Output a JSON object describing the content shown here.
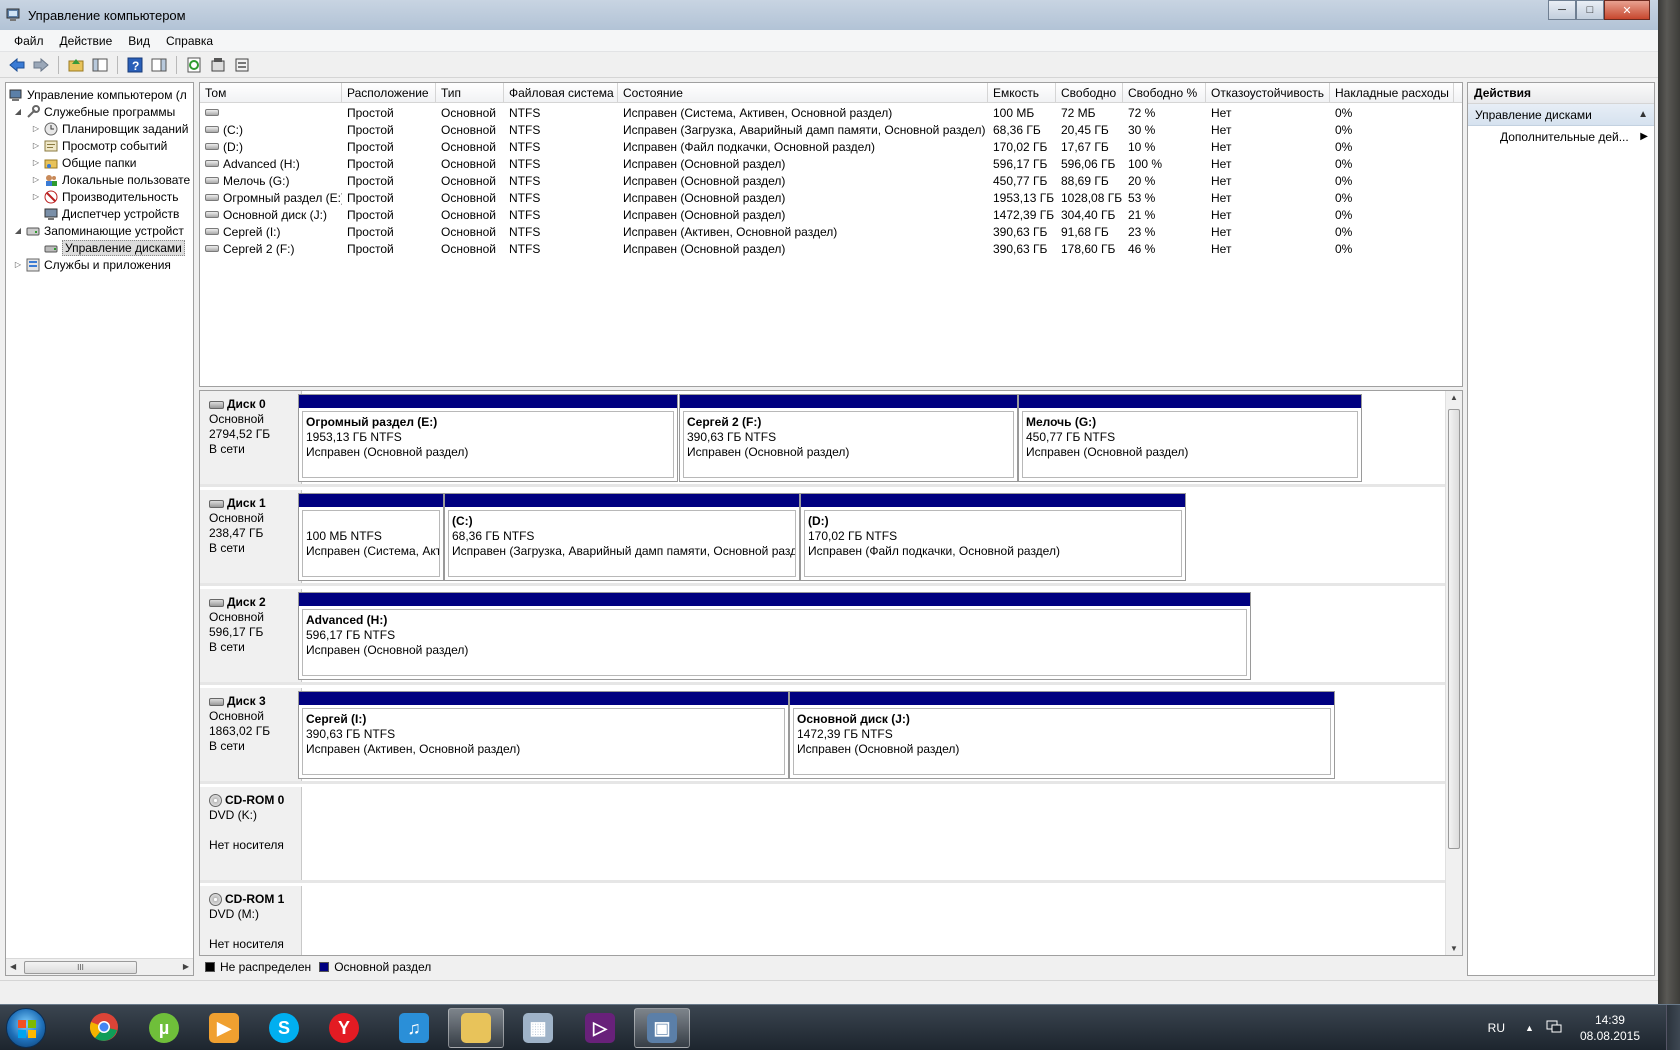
{
  "window": {
    "title": "Управление компьютером",
    "controls": {
      "minimize": "─",
      "maximize": "□",
      "close": "✕"
    }
  },
  "menu": [
    "Файл",
    "Действие",
    "Вид",
    "Справка"
  ],
  "toolbar_icons": [
    "back-arrow-icon",
    "forward-arrow-icon",
    "up-folder-icon",
    "show-hide-tree-icon",
    "help-icon",
    "show-hide-action-pane-icon",
    "refresh-icon",
    "properties-icon",
    "export-icon"
  ],
  "tree": {
    "root": "Управление компьютером (л",
    "items": [
      {
        "label": "Служебные программы",
        "level": 1,
        "expanded": true
      },
      {
        "label": "Планировщик заданий",
        "level": 2
      },
      {
        "label": "Просмотр событий",
        "level": 2
      },
      {
        "label": "Общие папки",
        "level": 2
      },
      {
        "label": "Локальные пользовате",
        "level": 2
      },
      {
        "label": "Производительность",
        "level": 2
      },
      {
        "label": "Диспетчер устройств",
        "level": 2
      },
      {
        "label": "Запоминающие устройст",
        "level": 1,
        "expanded": true
      },
      {
        "label": "Управление дисками",
        "level": 2,
        "selected": true
      },
      {
        "label": "Службы и приложения",
        "level": 1
      }
    ],
    "scroll_thumb": "III"
  },
  "volumes": {
    "columns": [
      "Том",
      "Расположение",
      "Тип",
      "Файловая система",
      "Состояние",
      "Емкость",
      "Свободно",
      "Свободно %",
      "Отказоустойчивость",
      "Накладные расходы"
    ],
    "rows": [
      [
        "",
        "Простой",
        "Основной",
        "NTFS",
        "Исправен (Система, Активен, Основной раздел)",
        "100 МБ",
        "72 МБ",
        "72 %",
        "Нет",
        "0%"
      ],
      [
        "(C:)",
        "Простой",
        "Основной",
        "NTFS",
        "Исправен (Загрузка, Аварийный дамп памяти, Основной раздел)",
        "68,36 ГБ",
        "20,45 ГБ",
        "30 %",
        "Нет",
        "0%"
      ],
      [
        "(D:)",
        "Простой",
        "Основной",
        "NTFS",
        "Исправен (Файл подкачки, Основной раздел)",
        "170,02 ГБ",
        "17,67 ГБ",
        "10 %",
        "Нет",
        "0%"
      ],
      [
        "Advanced (H:)",
        "Простой",
        "Основной",
        "NTFS",
        "Исправен (Основной раздел)",
        "596,17 ГБ",
        "596,06 ГБ",
        "100 %",
        "Нет",
        "0%"
      ],
      [
        "Мелочь (G:)",
        "Простой",
        "Основной",
        "NTFS",
        "Исправен (Основной раздел)",
        "450,77 ГБ",
        "88,69 ГБ",
        "20 %",
        "Нет",
        "0%"
      ],
      [
        "Огромный раздел (E:)",
        "Простой",
        "Основной",
        "NTFS",
        "Исправен (Основной раздел)",
        "1953,13 ГБ",
        "1028,08 ГБ",
        "53 %",
        "Нет",
        "0%"
      ],
      [
        "Основной диск (J:)",
        "Простой",
        "Основной",
        "NTFS",
        "Исправен (Основной раздел)",
        "1472,39 ГБ",
        "304,40 ГБ",
        "21 %",
        "Нет",
        "0%"
      ],
      [
        "Сергей (I:)",
        "Простой",
        "Основной",
        "NTFS",
        "Исправен (Активен, Основной раздел)",
        "390,63 ГБ",
        "91,68 ГБ",
        "23 %",
        "Нет",
        "0%"
      ],
      [
        "Сергей 2 (F:)",
        "Простой",
        "Основной",
        "NTFS",
        "Исправен (Основной раздел)",
        "390,63 ГБ",
        "178,60 ГБ",
        "46 %",
        "Нет",
        "0%"
      ]
    ]
  },
  "disks": [
    {
      "name": "Диск 0",
      "type": "Основной",
      "size": "2794,52 ГБ",
      "status": "В сети",
      "kind": "hdd",
      "partitions": [
        {
          "name": "Огромный раздел  (E:)",
          "size": "1953,13 ГБ NTFS",
          "state": "Исправен (Основной раздел)"
        },
        {
          "name": "Сергей 2  (F:)",
          "size": "390,63 ГБ NTFS",
          "state": "Исправен (Основной раздел)"
        },
        {
          "name": "Мелочь  (G:)",
          "size": "450,77 ГБ NTFS",
          "state": "Исправен (Основной раздел)"
        }
      ]
    },
    {
      "name": "Диск 1",
      "type": "Основной",
      "size": "238,47 ГБ",
      "status": "В сети",
      "kind": "hdd",
      "partitions": [
        {
          "name": "",
          "size": "100 МБ NTFS",
          "state": "Исправен (Система, Акти"
        },
        {
          "name": "(C:)",
          "size": "68,36 ГБ NTFS",
          "state": "Исправен (Загрузка, Аварийный дамп памяти, Основной раздел)"
        },
        {
          "name": "(D:)",
          "size": "170,02 ГБ NTFS",
          "state": "Исправен (Файл подкачки, Основной раздел)"
        }
      ]
    },
    {
      "name": "Диск 2",
      "type": "Основной",
      "size": "596,17 ГБ",
      "status": "В сети",
      "kind": "hdd",
      "partitions": [
        {
          "name": "Advanced  (H:)",
          "size": "596,17 ГБ NTFS",
          "state": "Исправен (Основной раздел)"
        }
      ]
    },
    {
      "name": "Диск 3",
      "type": "Основной",
      "size": "1863,02 ГБ",
      "status": "В сети",
      "kind": "hdd",
      "partitions": [
        {
          "name": "Сергей  (I:)",
          "size": "390,63 ГБ NTFS",
          "state": "Исправен (Активен, Основной раздел)"
        },
        {
          "name": "Основной диск  (J:)",
          "size": "1472,39 ГБ NTFS",
          "state": "Исправен (Основной раздел)"
        }
      ]
    },
    {
      "name": "CD-ROM 0",
      "type": "DVD (K:)",
      "size": "",
      "status": "Нет носителя",
      "kind": "cd",
      "partitions": []
    },
    {
      "name": "CD-ROM 1",
      "type": "DVD (M:)",
      "size": "",
      "status": "Нет носителя",
      "kind": "cd",
      "partitions": []
    }
  ],
  "legend": [
    {
      "label": "Не распределен",
      "color": "#000000"
    },
    {
      "label": "Основной раздел",
      "color": "#000080"
    }
  ],
  "actions": {
    "title": "Действия",
    "section": "Управление дисками",
    "item": "Дополнительные дей..."
  },
  "taskbar": {
    "apps": [
      "chrome",
      "utorrent",
      "media-player",
      "skype",
      "yandex-browser",
      "itunes",
      "file-explorer",
      "calculator",
      "visual-studio",
      "computer-management"
    ],
    "lang": "RU",
    "time": "14:39",
    "date": "08.08.2015"
  }
}
